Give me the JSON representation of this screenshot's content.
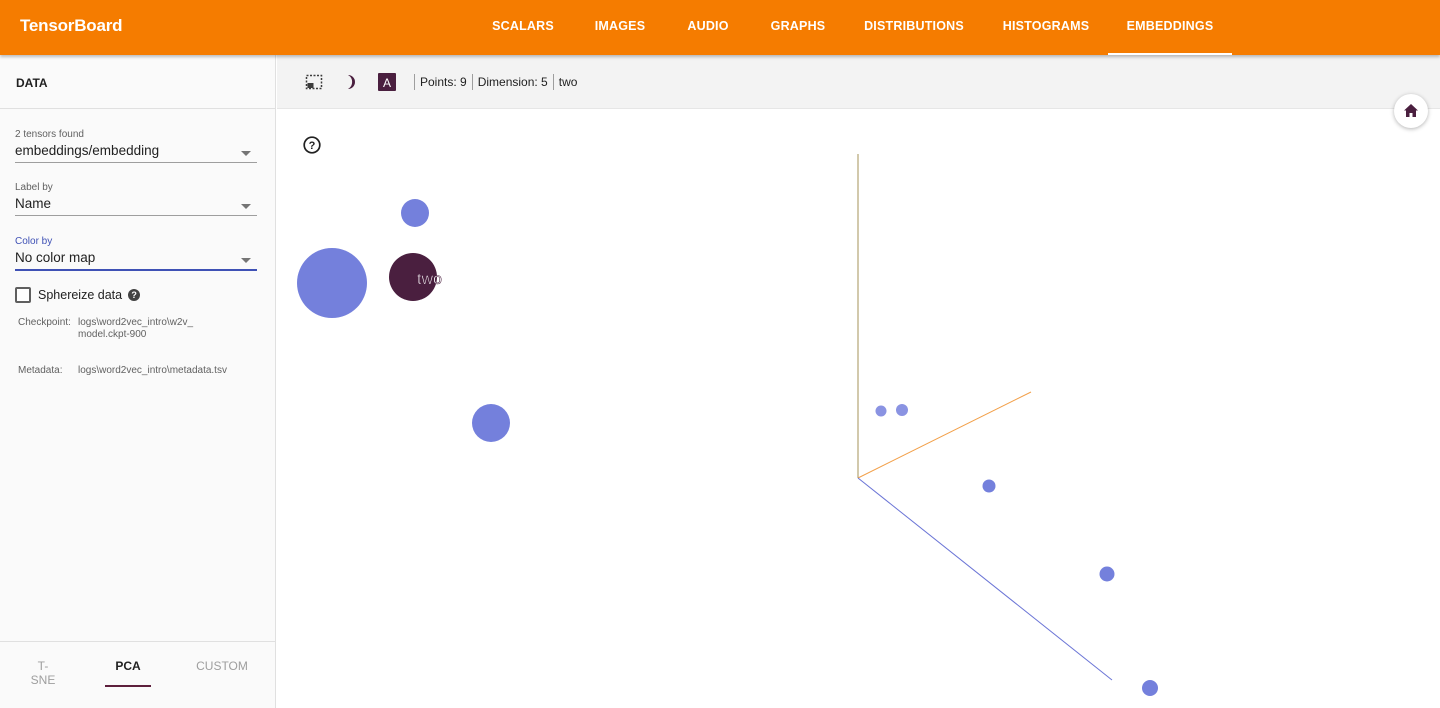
{
  "app": {
    "title": "TensorBoard"
  },
  "nav": {
    "tabs": [
      "SCALARS",
      "IMAGES",
      "AUDIO",
      "GRAPHS",
      "DISTRIBUTIONS",
      "HISTOGRAMS",
      "EMBEDDINGS"
    ],
    "active": "EMBEDDINGS"
  },
  "sidebar": {
    "header": "DATA",
    "tensors_found": "2 tensors found",
    "tensor_value": "embeddings/embedding",
    "label_by": {
      "label": "Label by",
      "value": "Name"
    },
    "color_by": {
      "label": "Color by",
      "value": "No color map"
    },
    "spherize": {
      "label": "Sphereize data",
      "checked": false,
      "help": "?"
    },
    "checkpoint": {
      "key": "Checkpoint:",
      "value_line1": "logs\\word2vec_intro\\w2v_",
      "value_line2": "model.ckpt-900"
    },
    "metadata": {
      "key": "Metadata:",
      "value": "logs\\word2vec_intro\\metadata.tsv"
    },
    "methods": {
      "tsne": "T-SNE",
      "pca": "PCA",
      "custom": "CUSTOM",
      "active": "PCA"
    }
  },
  "toolbar": {
    "icons": [
      "selection-icon",
      "night-mode-icon",
      "labels-icon"
    ],
    "points": "Points: 9",
    "dimension": "Dimension: 5",
    "selected": "two"
  },
  "plot": {
    "selected_label": "two",
    "colors": {
      "point": "#7480dc",
      "selected": "#4a1f3f",
      "axis_y": "#a6935a",
      "axis_x": "#f2a04a",
      "axis_z": "#6b75d6"
    }
  }
}
